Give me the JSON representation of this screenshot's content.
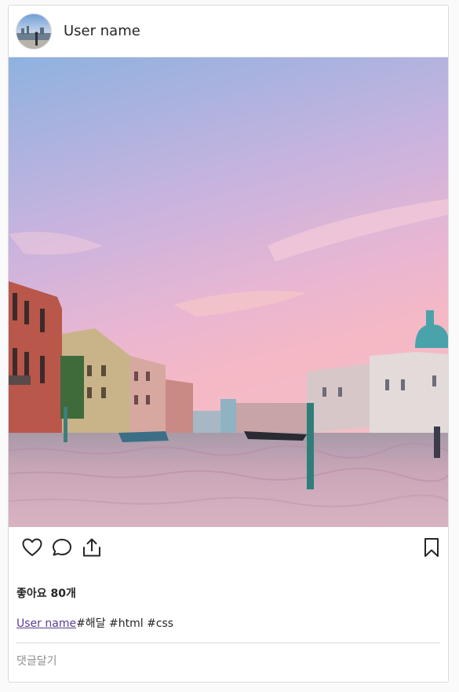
{
  "post": {
    "author": "User name",
    "likes_text": "좋아요 80개",
    "caption_author": "User name",
    "caption_text": "#해달 #html #css",
    "comment_placeholder": "댓글달기"
  },
  "icons": {
    "like": "heart-icon",
    "comment": "speech-bubble-icon",
    "share": "share-upload-icon",
    "save": "bookmark-icon"
  },
  "colors": {
    "link": "#5a3d91",
    "border": "#dbdbdb",
    "text": "#262626",
    "placeholder": "#8e8e8e"
  }
}
